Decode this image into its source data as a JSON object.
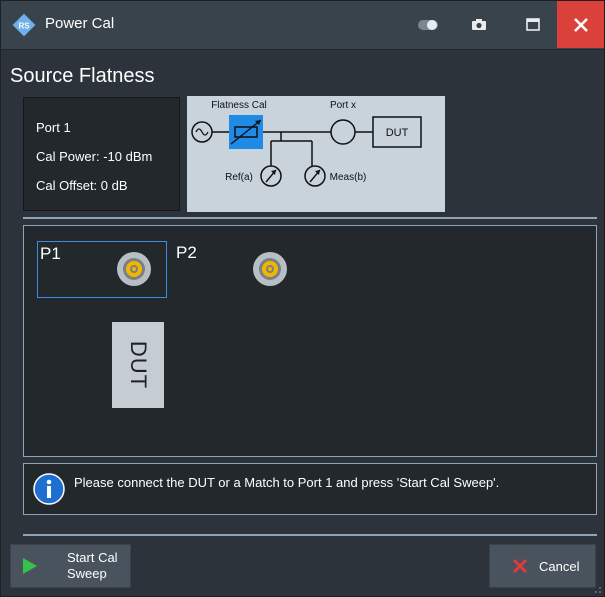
{
  "window": {
    "title": "Power Cal",
    "controls": [
      "toggle-icon",
      "camera-icon",
      "maximize-icon",
      "close-icon"
    ]
  },
  "heading": "Source Flatness",
  "info": {
    "port": "Port 1",
    "cal_power": "Cal Power:  -10 dBm",
    "cal_offset": "Cal Offset:  0 dB"
  },
  "schematic": {
    "flatness_cal": "Flatness Cal",
    "port_x": "Port x",
    "dut": "DUT",
    "ref": "Ref(a)",
    "meas": "Meas(b)"
  },
  "ports": {
    "p1": "P1",
    "p2": "P2",
    "selected": "P1"
  },
  "dut_label": "DUT",
  "message": "Please connect the DUT or a Match to Port 1 and press 'Start Cal Sweep'.",
  "buttons": {
    "start": "Start Cal\nSweep",
    "cancel": "Cancel"
  },
  "colors": {
    "accent_blue": "#3d8be0",
    "close_red": "#d9413a",
    "start_green": "#35c24a",
    "cancel_red": "#e03a3a",
    "highlight_blue": "#1f8be6"
  }
}
